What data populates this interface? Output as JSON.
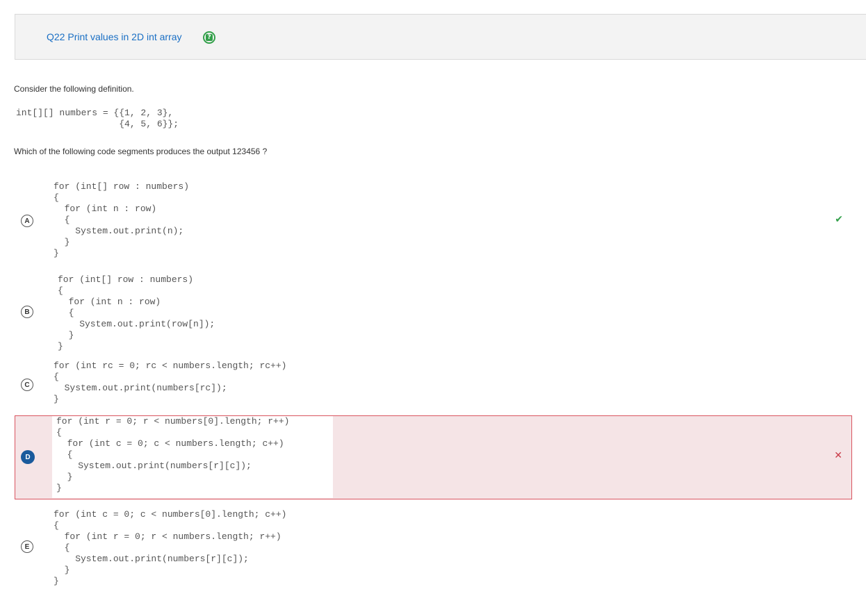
{
  "question": {
    "title": "Q22 Print values in 2D int array",
    "help_icon": "question-help-icon"
  },
  "prompt": {
    "intro": "Consider the following definition.",
    "definition_code": "int[][] numbers = {{1, 2, 3},\n                   {4, 5, 6}};",
    "question_text": "Which of the following code segments produces the output 123456 ?"
  },
  "choices": [
    {
      "letter": "A",
      "code": "for (int[] row : numbers)\n{\n  for (int n : row)\n  {\n    System.out.print(n);\n  }\n}",
      "result_icon": "check-icon",
      "result_symbol": "✔",
      "selected": false
    },
    {
      "letter": "B",
      "code": "for (int[] row : numbers)\n{\n  for (int n : row)\n  {\n    System.out.print(row[n]);\n  }\n}",
      "result_symbol": "",
      "selected": false
    },
    {
      "letter": "C",
      "code": "for (int rc = 0; rc < numbers.length; rc++)\n{\n  System.out.print(numbers[rc]);\n}",
      "result_symbol": "",
      "selected": false
    },
    {
      "letter": "D",
      "code": "for (int r = 0; r < numbers[0].length; r++)\n{\n  for (int c = 0; c < numbers.length; c++)\n  {\n    System.out.print(numbers[r][c]);\n  }\n}",
      "result_icon": "cross-icon",
      "result_symbol": "✕",
      "selected": true
    },
    {
      "letter": "E",
      "code": "for (int c = 0; c < numbers[0].length; c++)\n{\n  for (int r = 0; r < numbers.length; r++)\n  {\n    System.out.print(numbers[r][c]);\n  }\n}",
      "result_symbol": "",
      "selected": false
    }
  ],
  "colors": {
    "title_blue": "#1a6fc4",
    "correct_green": "#33a04a",
    "wrong_red": "#c93a47",
    "selected_bg": "#f5e4e6"
  }
}
